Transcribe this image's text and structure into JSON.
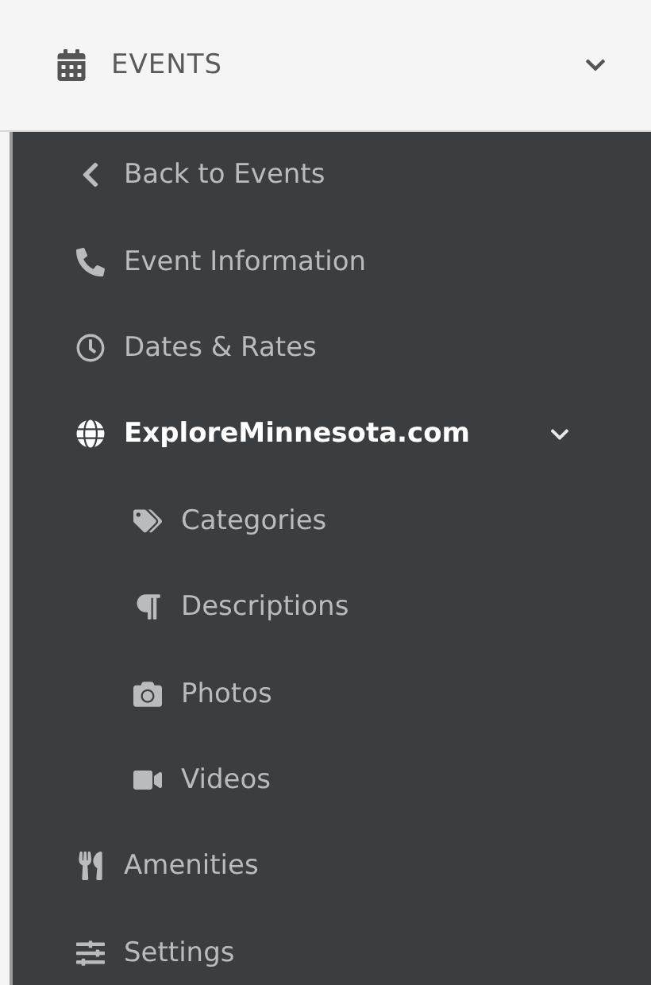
{
  "header": {
    "title": "EVENTS",
    "expanded": true
  },
  "menu": {
    "items": [
      {
        "label": "Back to Events",
        "selected": false
      },
      {
        "label": "Event Information",
        "selected": false
      },
      {
        "label": "Dates & Rates",
        "selected": false
      },
      {
        "label": "ExploreMinnesota.com",
        "selected": true,
        "expanded": true,
        "children": [
          {
            "label": "Categories",
            "selected": false
          },
          {
            "label": "Descriptions",
            "selected": false
          },
          {
            "label": "Photos",
            "selected": false
          },
          {
            "label": "Videos",
            "selected": false
          }
        ]
      },
      {
        "label": "Amenities",
        "selected": false
      },
      {
        "label": "Settings",
        "selected": false
      }
    ]
  }
}
